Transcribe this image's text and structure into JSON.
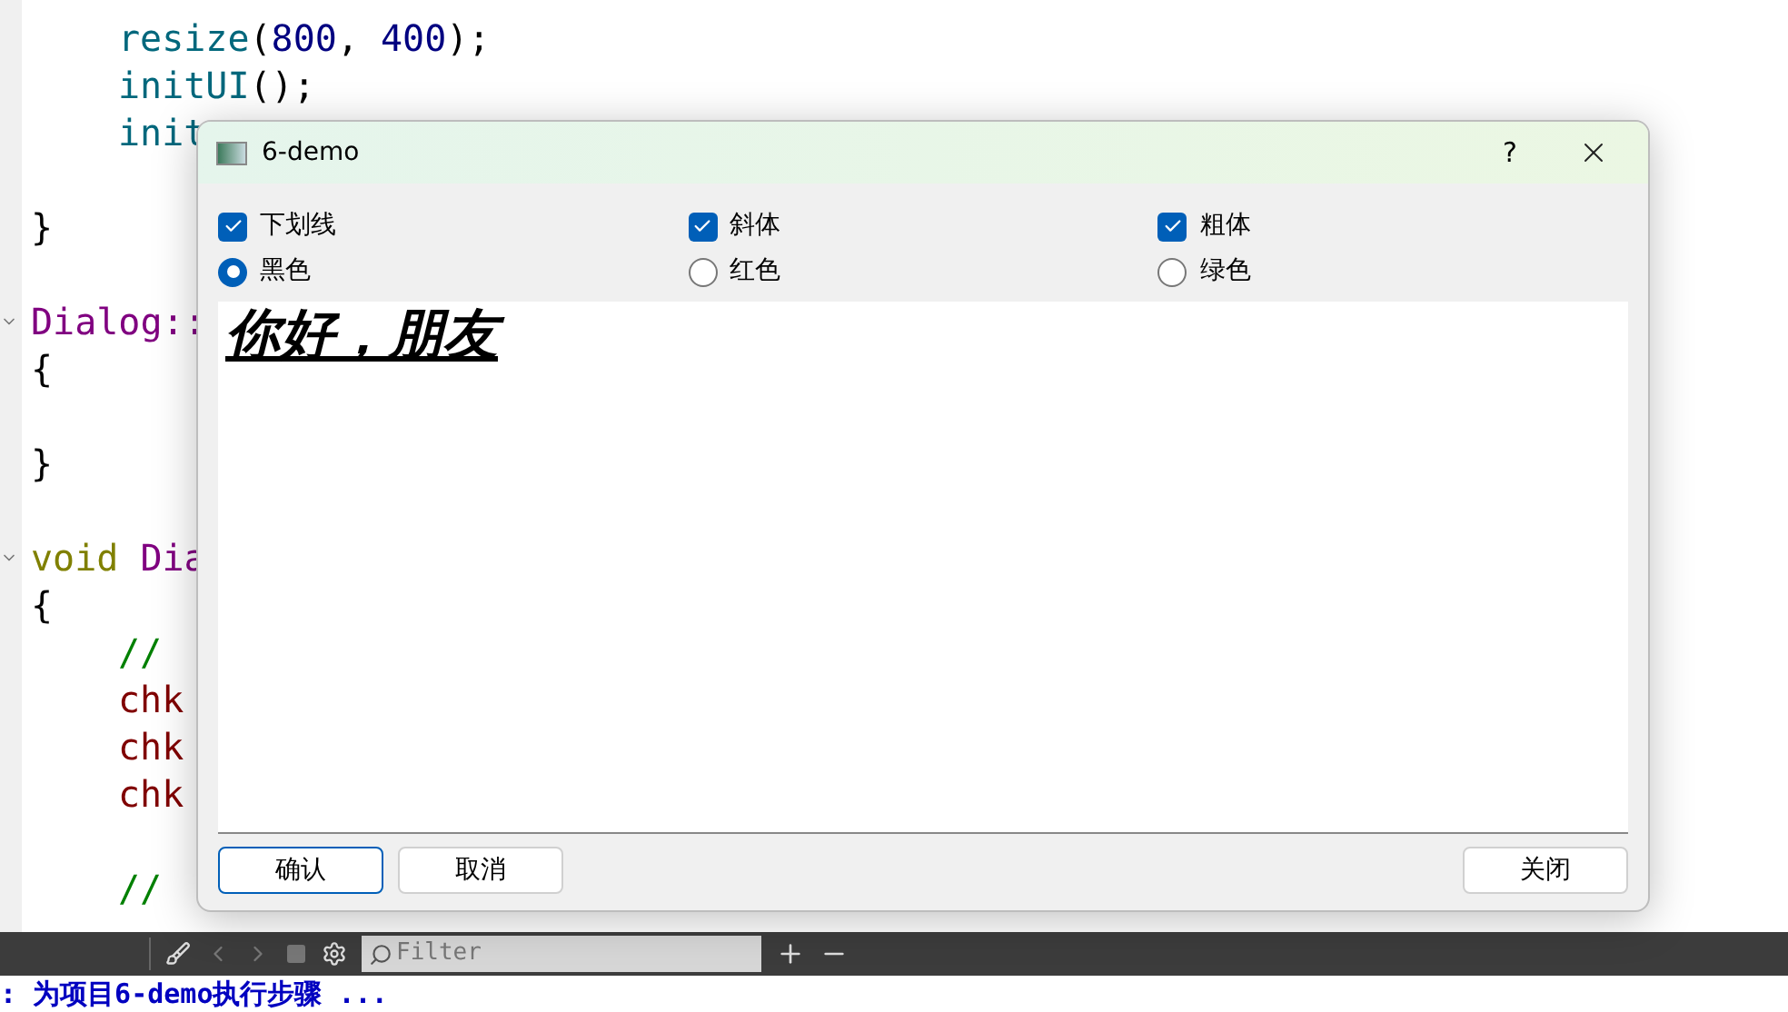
{
  "editor": {
    "lines": [
      {
        "kind": "code",
        "indent": true,
        "tokens": [
          {
            "text": "resize",
            "kind": "function"
          },
          {
            "text": "(",
            "kind": "plain"
          },
          {
            "text": "800",
            "kind": "number"
          },
          {
            "text": ", ",
            "kind": "plain"
          },
          {
            "text": "400",
            "kind": "number"
          },
          {
            "text": ");",
            "kind": "plain"
          }
        ]
      },
      {
        "kind": "code",
        "indent": true,
        "tokens": [
          {
            "text": "initUI",
            "kind": "function"
          },
          {
            "text": "();",
            "kind": "plain"
          }
        ]
      },
      {
        "kind": "code",
        "indent": true,
        "tokens": [
          {
            "text": "init",
            "kind": "function"
          }
        ]
      },
      {
        "kind": "blank"
      },
      {
        "kind": "code",
        "indent": false,
        "tokens": [
          {
            "text": "}",
            "kind": "plain"
          }
        ]
      },
      {
        "kind": "blank"
      },
      {
        "kind": "code",
        "indent": false,
        "foldable": true,
        "tokens": [
          {
            "text": "Dialog::",
            "kind": "type"
          }
        ]
      },
      {
        "kind": "code",
        "indent": false,
        "tokens": [
          {
            "text": "{",
            "kind": "plain"
          }
        ]
      },
      {
        "kind": "blank"
      },
      {
        "kind": "code",
        "indent": false,
        "tokens": [
          {
            "text": "}",
            "kind": "plain"
          }
        ]
      },
      {
        "kind": "blank"
      },
      {
        "kind": "code",
        "indent": false,
        "foldable": true,
        "tokens": [
          {
            "text": "void ",
            "kind": "keyword"
          },
          {
            "text": "Dia",
            "kind": "type"
          }
        ]
      },
      {
        "kind": "code",
        "indent": false,
        "tokens": [
          {
            "text": "{",
            "kind": "plain"
          }
        ]
      },
      {
        "kind": "code",
        "indent": true,
        "tokens": [
          {
            "text": "//",
            "kind": "comment"
          }
        ]
      },
      {
        "kind": "code",
        "indent": true,
        "tokens": [
          {
            "text": "chk",
            "kind": "member"
          }
        ]
      },
      {
        "kind": "code",
        "indent": true,
        "tokens": [
          {
            "text": "chk",
            "kind": "member"
          }
        ]
      },
      {
        "kind": "code",
        "indent": true,
        "tokens": [
          {
            "text": "chk",
            "kind": "member"
          }
        ]
      },
      {
        "kind": "blank"
      },
      {
        "kind": "code",
        "indent": true,
        "tokens": [
          {
            "text": "//",
            "kind": "comment"
          }
        ]
      }
    ]
  },
  "toolbar": {
    "filter": {
      "placeholder": "Filter"
    }
  },
  "output_line": ": 为项目6-demo执行步骤 ...",
  "dialog": {
    "title": "6-demo",
    "help": "?",
    "checkboxes": [
      {
        "label": "下划线",
        "checked": true,
        "kind": "underline"
      },
      {
        "label": "斜体",
        "checked": true,
        "kind": "italic"
      },
      {
        "label": "粗体",
        "checked": true,
        "kind": "bold"
      }
    ],
    "radios": [
      {
        "label": "黑色",
        "selected": true
      },
      {
        "label": "红色",
        "selected": false
      },
      {
        "label": "绿色",
        "selected": false
      }
    ],
    "preview": "你好，朋友",
    "buttons": [
      {
        "label": "确认",
        "selected": true
      },
      {
        "label": "取消",
        "selected": false
      },
      {
        "label": "关闭",
        "selected": false
      }
    ]
  }
}
